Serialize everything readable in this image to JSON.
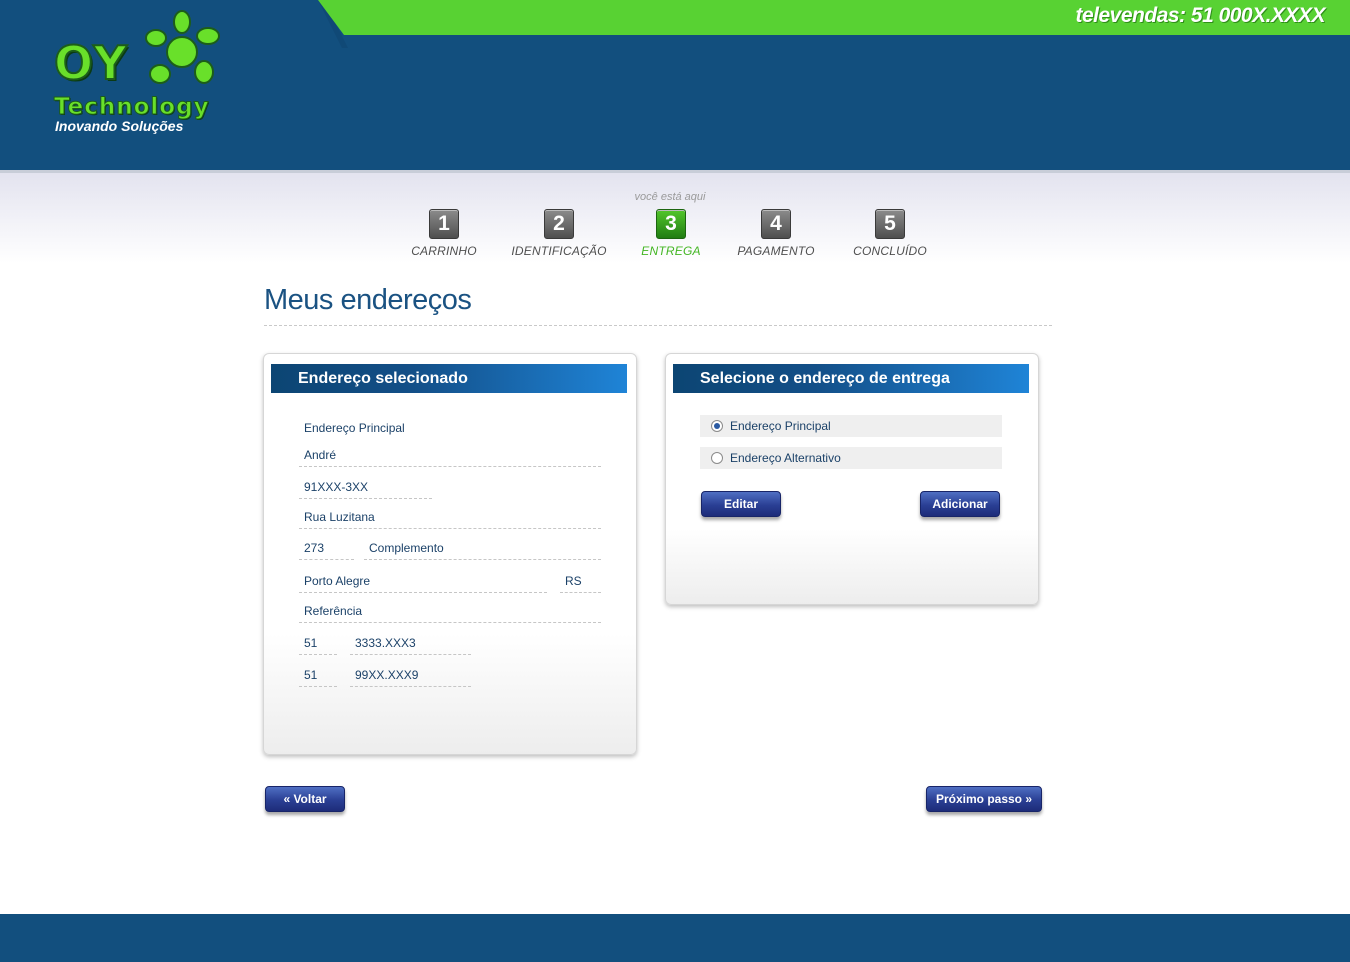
{
  "header": {
    "televendas": "televendas: 51 000X.XXXX",
    "logo": {
      "name": "OY",
      "tagline": "Technology",
      "slogan": "Inovando Soluções"
    }
  },
  "steps": {
    "here_label": "você está aqui",
    "items": [
      {
        "number": "1",
        "label": "CARRINHO"
      },
      {
        "number": "2",
        "label": "IDENTIFICAÇÃO"
      },
      {
        "number": "3",
        "label": "ENTREGA"
      },
      {
        "number": "4",
        "label": "PAGAMENTO"
      },
      {
        "number": "5",
        "label": "CONCLUÍDO"
      }
    ]
  },
  "page": {
    "title": "Meus endereços"
  },
  "selected_address": {
    "heading": "Endereço selecionado",
    "name_label": "Endereço Principal",
    "recipient": "André",
    "zip": "91XXX-3XX",
    "street": "Rua Luzitana",
    "number": "273",
    "complement": "Complemento",
    "city": "Porto Alegre",
    "state": "RS",
    "reference": "Referência",
    "phone1_area": "51",
    "phone1_number": "3333.XXX3",
    "phone2_area": "51",
    "phone2_number": "99XX.XXX9"
  },
  "delivery": {
    "heading": "Selecione o endereço de entrega",
    "options": [
      {
        "label": "Endereço Principal",
        "selected": true
      },
      {
        "label": "Endereço Alternativo",
        "selected": false
      }
    ],
    "edit_label": "Editar",
    "add_label": "Adicionar"
  },
  "nav": {
    "back_label": "« Voltar",
    "next_label": "Próximo passo »"
  },
  "colors": {
    "header_blue": "#124f7e",
    "brand_green": "#58d233",
    "button_blue": "#2a3f94"
  }
}
